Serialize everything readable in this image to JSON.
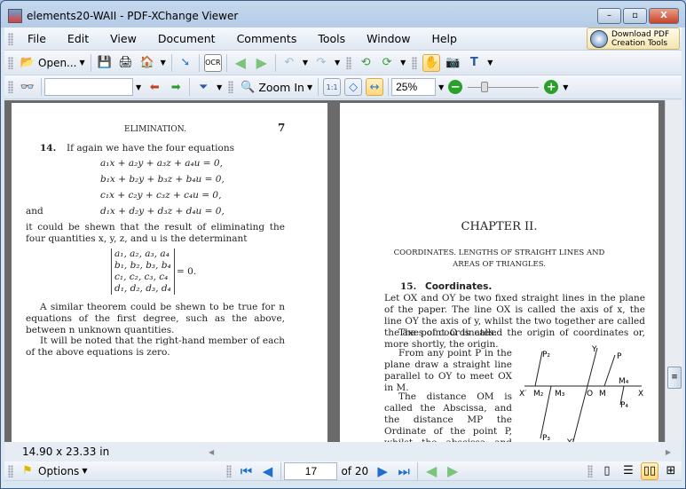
{
  "window": {
    "title": "elements20-WAII - PDF-XChange Viewer",
    "minimize": "–",
    "maximize": "▫",
    "close": "X"
  },
  "menu": [
    "File",
    "Edit",
    "View",
    "Document",
    "Comments",
    "Tools",
    "Window",
    "Help"
  ],
  "promo": {
    "line1": "Download PDF",
    "line2": "Creation Tools"
  },
  "toolbar1": {
    "open_label": "Open...",
    "ocr": "OCR"
  },
  "toolbar2": {
    "search_value": "",
    "zoom_in_label": "Zoom In",
    "zoom_value": "25%",
    "zoom_slider_fraction": 0.2
  },
  "status": {
    "page_size": "14.90 x 23.33 in"
  },
  "nav": {
    "options_label": "Options",
    "current_page": "17",
    "of_pages": "of 20"
  },
  "left_page": {
    "header": "ELIMINATION.",
    "page_number": "7",
    "section_number": "14.",
    "intro": "If again we have the four equations",
    "equations": [
      "a₁x + a₂y + a₃z + a₄u = 0,",
      "b₁x + b₂y + b₃z + b₄u = 0,",
      "c₁x + c₂y + c₃z + c₄u = 0,",
      "d₁x + d₂y + d₃z + d₄u = 0,"
    ],
    "and": "and",
    "p1": "it could be shewn that the result of eliminating the four quantities x, y, z, and u is the determinant",
    "determinant": [
      "a₁, a₂, a₃, a₄",
      "b₁, b₂, b₃, b₄",
      "c₁, c₂, c₃, c₄",
      "d₁, d₂, d₃, d₄"
    ],
    "det_eq": "= 0.",
    "p2": "A similar theorem could be shewn to be true for n equations of the first degree, such as the above, between n unknown quantities.",
    "p3": "It will be noted that the right-hand member of each of the above equations is zero."
  },
  "right_page": {
    "chapter": "CHAPTER II.",
    "subtitle1": "COORDINATES.   LENGTHS OF STRAIGHT LINES AND",
    "subtitle2": "AREAS OF TRIANGLES.",
    "section_number": "15.",
    "section_title": "Coordinates.",
    "p1": "Let OX and OY be two fixed straight lines in the plane of the paper.  The line OX is called the axis of x, the line OY the axis of y, whilst the two together are called the axes of coordinates.",
    "p2": "The point O is called the origin of coordinates or, more shortly, the origin.",
    "p3": "From any point P in the plane draw a straight line parallel to OY to meet OX in M.",
    "p4": "The distance OM is called the Abscissa, and the distance MP the Ordinate of the point P, whilst the abscissa and the ordinate together are called",
    "figure_labels": {
      "Y": "Y",
      "P": "P",
      "P2": "P₂",
      "Xp": "X′",
      "M2": "M₂",
      "M3": "M₃",
      "O": "O",
      "M": "M",
      "M4": "M₄",
      "X": "X",
      "P4": "P₄",
      "P3": "P₃",
      "Yp": "Y′"
    }
  }
}
